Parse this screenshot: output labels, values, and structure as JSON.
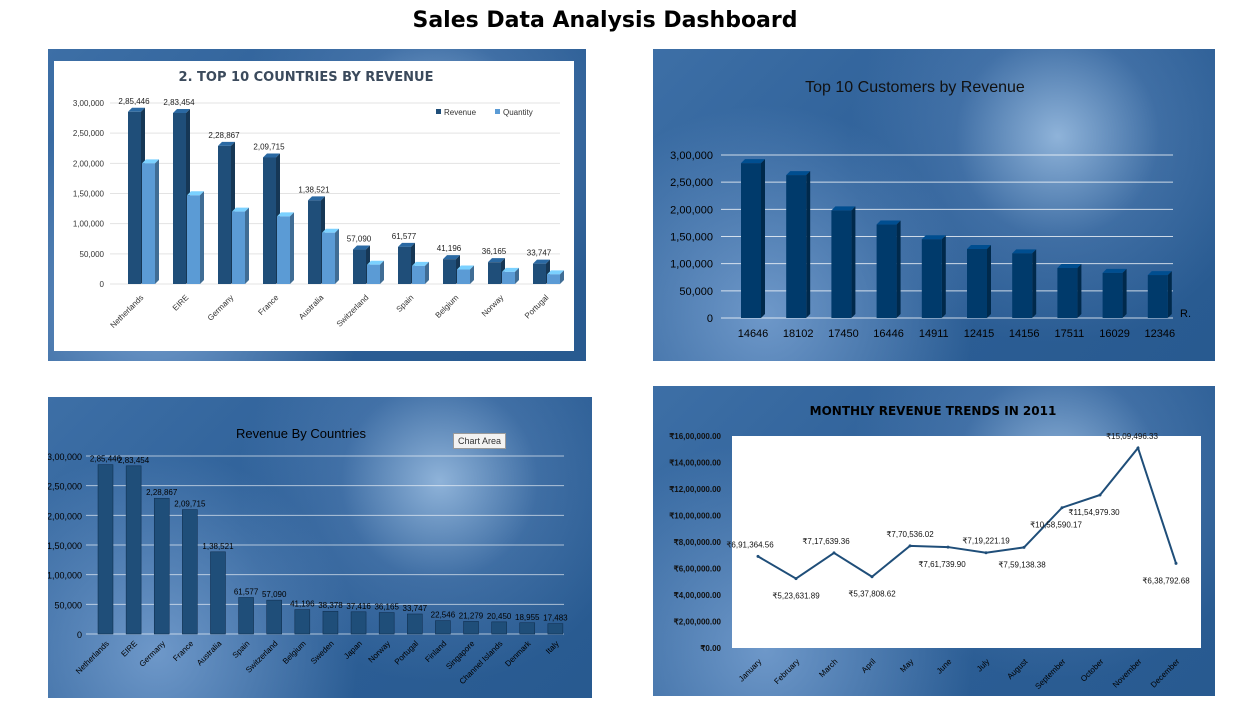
{
  "page_title": "Sales Data Analysis Dashboard",
  "chart_data": [
    {
      "type": "bar",
      "title": "2. TOP 10 COUNTRIES BY REVENUE",
      "categories": [
        "Netherlands",
        "EIRE",
        "Germany",
        "France",
        "Australia",
        "Switzerland",
        "Spain",
        "Belgium",
        "Norway",
        "Portugal"
      ],
      "series": [
        {
          "name": "Revenue",
          "values": [
            285446,
            283454,
            228867,
            209715,
            138521,
            57090,
            61577,
            41196,
            36165,
            33747
          ],
          "color": "#1f4e79"
        },
        {
          "name": "Quantity",
          "values": [
            200000,
            147000,
            120000,
            112000,
            85000,
            32000,
            30000,
            24000,
            20000,
            16000
          ],
          "color": "#5b9bd5"
        }
      ],
      "data_labels": [
        "2,85,446",
        "2,83,454",
        "2,28,867",
        "2,09,715",
        "1,38,521",
        "57,090",
        "61,577",
        "41,196",
        "36,165",
        "33,747"
      ],
      "y_ticks": [
        "0",
        "50,000",
        "1,00,000",
        "1,50,000",
        "2,00,000",
        "2,50,000",
        "3,00,000"
      ],
      "ylim": [
        0,
        300000
      ],
      "legend": "top-right"
    },
    {
      "type": "bar",
      "title": "Top 10 Customers by Revenue",
      "categories": [
        "14646",
        "18102",
        "17450",
        "16446",
        "14911",
        "12415",
        "14156",
        "17511",
        "16029",
        "12346"
      ],
      "values": [
        285000,
        263000,
        198000,
        172000,
        145000,
        127000,
        119000,
        92000,
        83000,
        79000
      ],
      "y_ticks": [
        "0",
        "50,000",
        "1,00,000",
        "1,50,000",
        "2,00,000",
        "2,50,000",
        "3,00,000"
      ],
      "ylim": [
        0,
        300000
      ],
      "axis_suffix": "R.",
      "color": "#003a6b"
    },
    {
      "type": "bar",
      "title": "Revenue By Countries",
      "categories": [
        "Netherlands",
        "EIRE",
        "Germany",
        "France",
        "Australia",
        "Spain",
        "Switzerland",
        "Belgium",
        "Sweden",
        "Japan",
        "Norway",
        "Portugal",
        "Finland",
        "Singapore",
        "Channel Islands",
        "Denmark",
        "Italy"
      ],
      "values": [
        285446,
        283454,
        228867,
        209715,
        138521,
        61577,
        57090,
        41196,
        38378,
        37416,
        36165,
        33747,
        22546,
        21279,
        20450,
        18955,
        17483
      ],
      "data_labels": [
        "2,85,446",
        "2,83,454",
        "2,28,867",
        "2,09,715",
        "1,38,521",
        "61,577",
        "57,090",
        "41,196",
        "38,378",
        "37,416",
        "36,165",
        "33,747",
        "22,546",
        "21,279",
        "20,450",
        "18,955",
        "17,483"
      ],
      "y_ticks": [
        "0",
        "50,000",
        "1,00,000",
        "1,50,000",
        "2,00,000",
        "2,50,000",
        "3,00,000"
      ],
      "ylim": [
        0,
        300000
      ],
      "badge": "Chart Area",
      "color": "#1f4e79"
    },
    {
      "type": "line",
      "title": "MONTHLY REVENUE TRENDS IN 2011",
      "categories": [
        "January",
        "February",
        "March",
        "April",
        "May",
        "June",
        "July",
        "August",
        "September",
        "October",
        "November",
        "December"
      ],
      "values": [
        691364.56,
        523631.89,
        717639.36,
        537808.62,
        770536.02,
        761739.9,
        719221.19,
        759138.38,
        1058590.17,
        1154979.3,
        1509496.33,
        638792.68
      ],
      "data_labels": [
        "₹6,91,364.56",
        "₹5,23,631.89",
        "₹7,17,639.36",
        "₹5,37,808.62",
        "₹7,70,536.02",
        "₹7,61,739.90",
        "₹7,19,221.19",
        "₹7,59,138.38",
        "₹10,58,590.17",
        "₹11,54,979.30",
        "₹15,09,496.33",
        "₹6,38,792.68"
      ],
      "y_ticks": [
        "₹0.00",
        "₹2,00,000.00",
        "₹4,00,000.00",
        "₹6,00,000.00",
        "₹8,00,000.00",
        "₹10,00,000.00",
        "₹12,00,000.00",
        "₹14,00,000.00",
        "₹16,00,000.00"
      ],
      "ylim": [
        0,
        1600000
      ],
      "color": "#1f4e79"
    }
  ]
}
